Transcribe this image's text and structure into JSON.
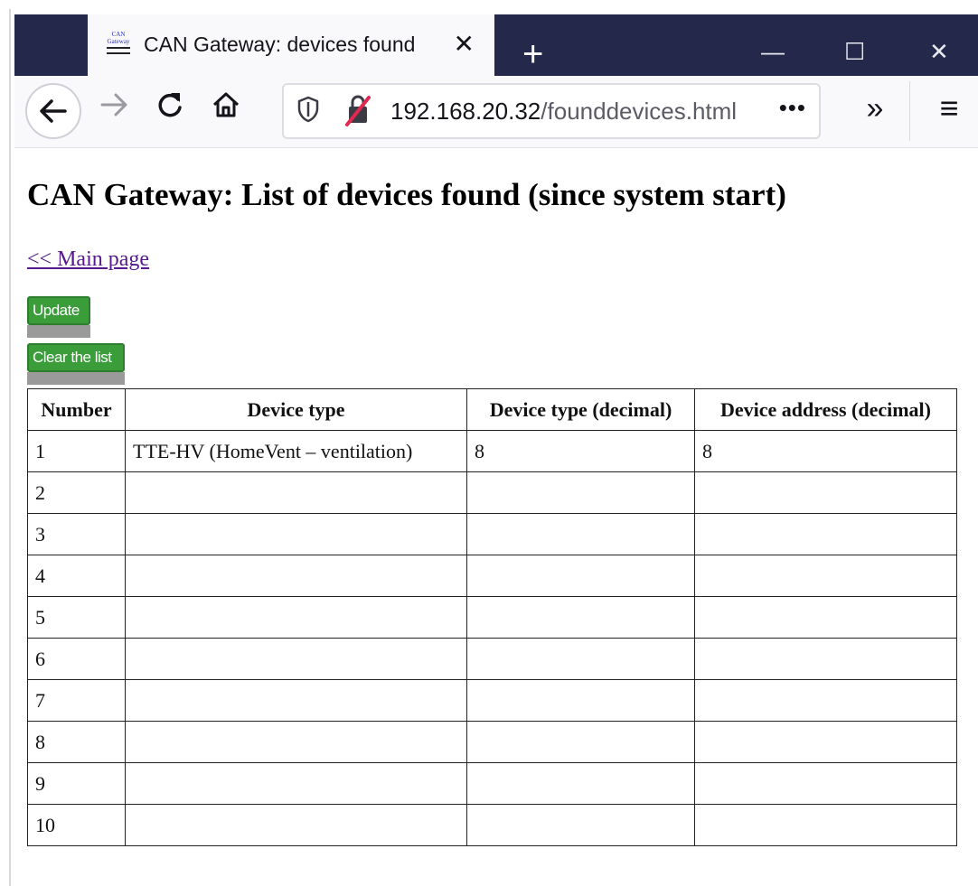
{
  "browser": {
    "tab_title": "CAN Gateway: devices found",
    "favicon_text": "CAN Gateway",
    "tab_close_glyph": "✕",
    "new_tab_glyph": "+",
    "minimize_glyph": "—",
    "maximize_glyph": "☐",
    "close_glyph": "✕",
    "url_host": "192.168.20.32",
    "url_path": "/founddevices.html",
    "more_glyph": "•••",
    "overflow_glyph": "»",
    "menu_glyph": "≡",
    "icons": [
      "back-arrow-icon",
      "forward-arrow-icon",
      "reload-icon",
      "home-icon",
      "shield-icon",
      "insecure-lock-icon"
    ]
  },
  "page": {
    "title": "CAN Gateway: List of devices found (since system start)",
    "main_link": "<< Main page",
    "update_button": "Update",
    "clear_button": "Clear the list",
    "button_color": "#3a9d3a"
  },
  "table": {
    "headers": [
      "Number",
      "Device type",
      "Device type (decimal)",
      "Device address (decimal)"
    ],
    "rows": [
      [
        "1",
        "TTE-HV (HomeVent – ventilation)",
        "8",
        "8"
      ],
      [
        "2",
        "",
        "",
        ""
      ],
      [
        "3",
        "",
        "",
        ""
      ],
      [
        "4",
        "",
        "",
        ""
      ],
      [
        "5",
        "",
        "",
        ""
      ],
      [
        "6",
        "",
        "",
        ""
      ],
      [
        "7",
        "",
        "",
        ""
      ],
      [
        "8",
        "",
        "",
        ""
      ],
      [
        "9",
        "",
        "",
        ""
      ],
      [
        "10",
        "",
        "",
        ""
      ]
    ]
  }
}
